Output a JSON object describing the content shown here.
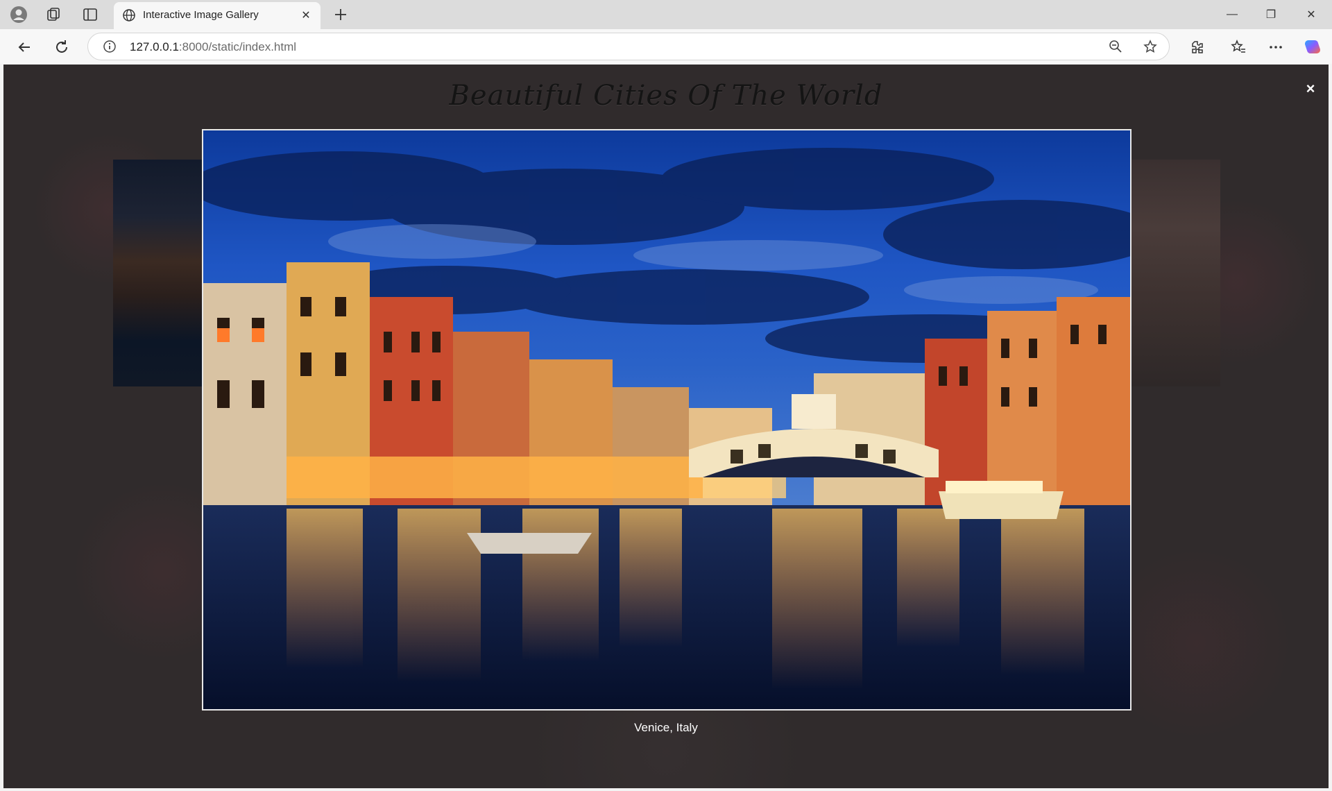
{
  "browser": {
    "tab_title": "Interactive Image Gallery",
    "url_host": "127.0.0.1",
    "url_rest": ":8000/static/index.html",
    "icons": {
      "profile": "profile-icon",
      "collections": "collections-icon",
      "tab_actions": "tab-actions-icon",
      "site": "globe-icon",
      "close_tab": "close-icon",
      "new_tab": "plus-icon",
      "minimize": "minimize-icon",
      "restore": "restore-icon",
      "close_window": "close-icon",
      "back": "back-arrow-icon",
      "refresh": "refresh-icon",
      "info": "info-icon",
      "zoom": "zoom-out-icon",
      "favorite": "star-icon",
      "extensions": "extensions-icon",
      "favorites_bar": "favorites-icon",
      "more": "more-icon",
      "copilot": "copilot-icon"
    }
  },
  "gallery": {
    "title": "Beautiful Cities Of The World",
    "close_label": "×",
    "current_caption": "Venice, Italy"
  }
}
